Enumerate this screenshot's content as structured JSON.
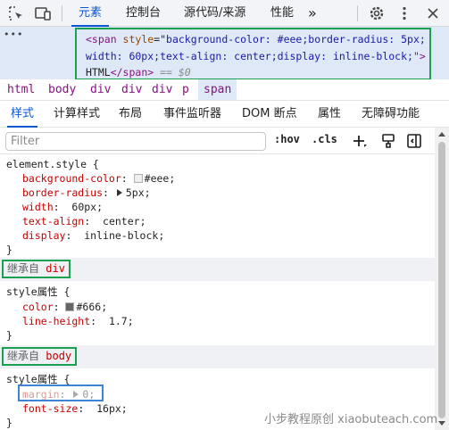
{
  "toolbar": {
    "tabs": [
      "元素",
      "控制台",
      "源代码/来源",
      "性能"
    ],
    "more": "»"
  },
  "dom": {
    "dots": "•••",
    "line1_tag_open": "<span",
    "line1_attr": " style",
    "line1_eq": "=\"",
    "line1_val": "background-color: #eee;border-radius: 5px;",
    "line2_val": "width: 60px;text-align: center;display: inline-block;",
    "line2_close": "\">",
    "line3_text": "HTML",
    "line3_tag_close": "</span>",
    "line3_eq": " == $0"
  },
  "breadcrumbs": [
    "html",
    "body",
    "div",
    "div",
    "div",
    "p",
    "span"
  ],
  "subtabs": [
    "样式",
    "计算样式",
    "布局",
    "事件监听器",
    "DOM 断点",
    "属性",
    "无障碍功能"
  ],
  "filter": {
    "placeholder": "Filter",
    "hov": ":hov",
    "cls": ".cls"
  },
  "rules": {
    "element_style": {
      "selector": "element.style {",
      "decls": [
        {
          "prop": "background-color",
          "value": "#eee",
          "swatch": "#eeeeee"
        },
        {
          "prop": "border-radius",
          "value": "5px",
          "expand": true
        },
        {
          "prop": "width",
          "value": "60px"
        },
        {
          "prop": "text-align",
          "value": "center"
        },
        {
          "prop": "display",
          "value": "inline-block"
        }
      ],
      "close": "}"
    },
    "inherit_div": {
      "label": "继承自",
      "el": "div"
    },
    "div_style": {
      "selector": "style属性 {",
      "decls": [
        {
          "prop": "color",
          "value": "#666",
          "swatch": "#666666"
        },
        {
          "prop": "line-height",
          "value": "1.7"
        }
      ],
      "close": "}"
    },
    "inherit_body": {
      "label": "继承自",
      "el": "body"
    },
    "body_style": {
      "selector": "style属性 {",
      "decls": [
        {
          "prop": "margin",
          "value": "0;",
          "expand": true,
          "struck": true
        },
        {
          "prop": "font-size",
          "value": "16px"
        }
      ],
      "close": "}"
    }
  },
  "watermark": "小步教程原创 xiaobuteach.com",
  "colors": {
    "accent": "#0b57d0",
    "highlight_green": "#1aa150",
    "highlight_blue": "#3d84d6",
    "prop_red": "#c80000"
  }
}
